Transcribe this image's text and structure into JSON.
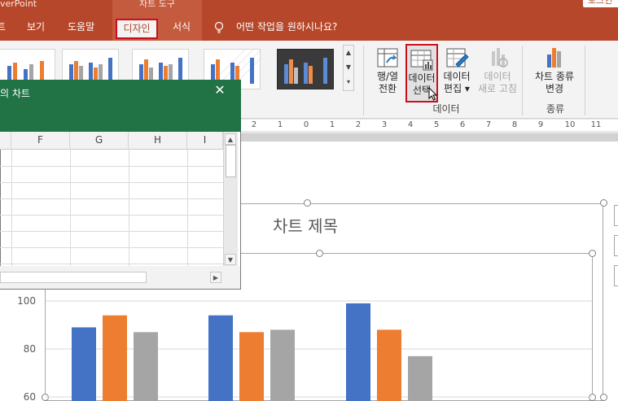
{
  "window": {
    "app_title": "verPoint",
    "context_title": "차트 도구",
    "signin": "로그인"
  },
  "tabs": {
    "home": "트",
    "view": "보기",
    "help": "도움말",
    "design": "디자인",
    "format": "서식",
    "tell_me": "어떤 작업을 원하시나요?"
  },
  "ribbon": {
    "switch_row_col": [
      "행/열",
      "전환"
    ],
    "select_data": [
      "데이터",
      "선택"
    ],
    "edit_data": [
      "데이터",
      "편집 ▾"
    ],
    "refresh_data": [
      "데이터",
      "새로 고침"
    ],
    "change_chart_type": [
      "차트 종류",
      "변경"
    ],
    "group_data": "데이터",
    "group_type": "종류"
  },
  "ruler": {
    "labels": [
      "2",
      "1",
      "0",
      "1",
      "2",
      "3",
      "4",
      "5",
      "6",
      "7",
      "8",
      "9",
      "10",
      "11"
    ]
  },
  "excel": {
    "title": "의 차트",
    "close": "✕",
    "columns": [
      "F",
      "G",
      "H",
      "I"
    ]
  },
  "chart": {
    "title": "차트 제목"
  },
  "chart_data": {
    "type": "bar",
    "title": "차트 제목",
    "ylim": [
      60,
      100
    ],
    "yticks": [
      100,
      80,
      60
    ],
    "grid": true,
    "series": [
      {
        "color": "#4472c4",
        "values": [
          89,
          94,
          99
        ]
      },
      {
        "color": "#ed7d31",
        "values": [
          94,
          87,
          88
        ]
      },
      {
        "color": "#a5a5a5",
        "values": [
          87,
          88,
          77
        ]
      }
    ]
  }
}
